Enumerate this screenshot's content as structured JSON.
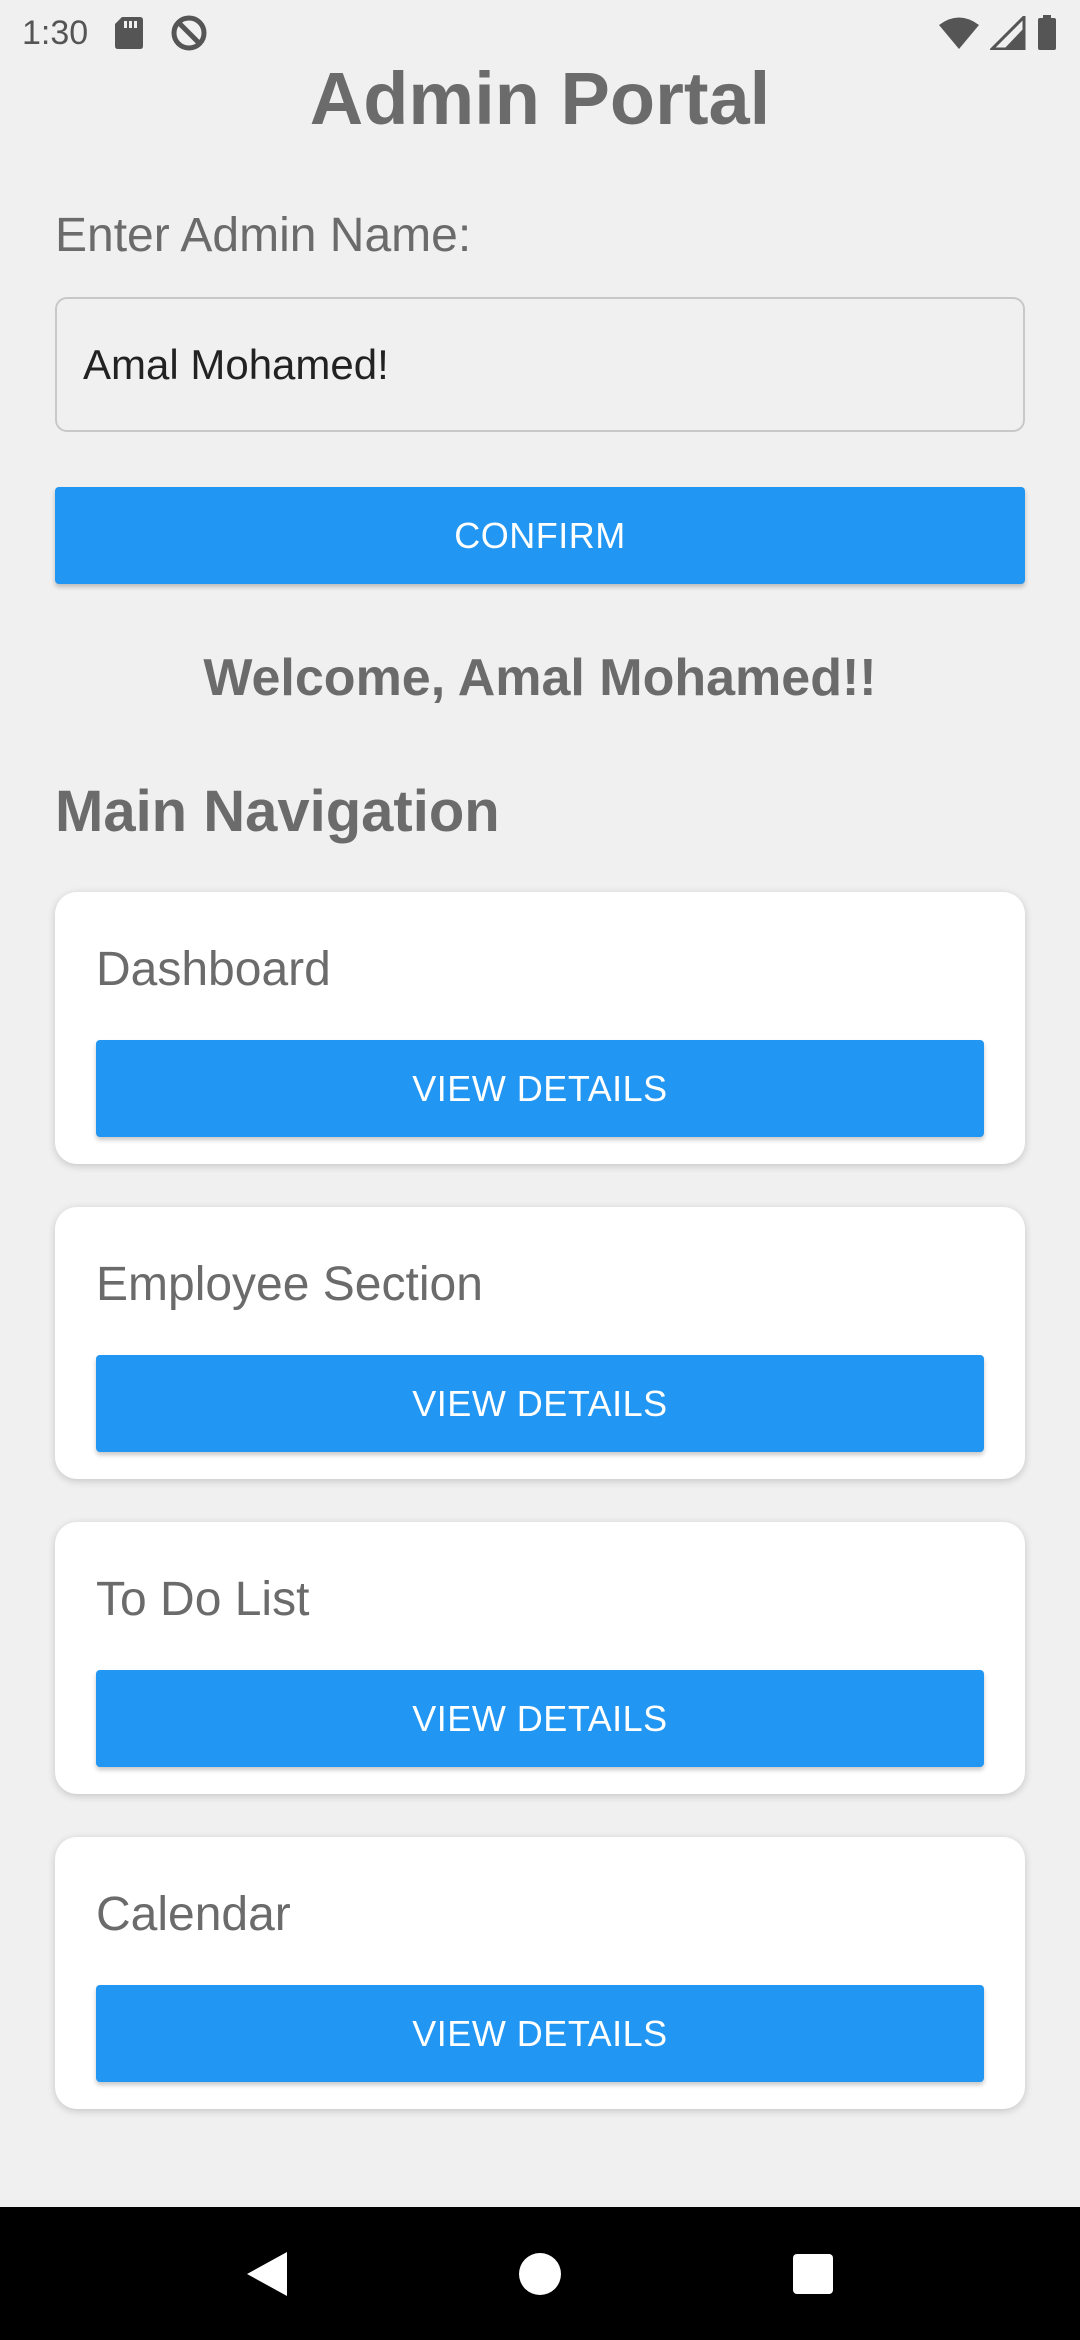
{
  "status_bar": {
    "time": "1:30",
    "icons": [
      "sd-card-icon",
      "data-saver-icon",
      "wifi-icon",
      "signal-icon",
      "battery-icon"
    ]
  },
  "app": {
    "title": "Admin Portal"
  },
  "admin_form": {
    "label": "Enter Admin Name:",
    "name_value": "Amal Mohamed!",
    "confirm_label": "CONFIRM"
  },
  "welcome_text": "Welcome, Amal Mohamed!!",
  "navigation": {
    "heading": "Main Navigation",
    "items": [
      {
        "title": "Dashboard",
        "button": "VIEW DETAILS"
      },
      {
        "title": "Employee Section",
        "button": "VIEW DETAILS"
      },
      {
        "title": "To Do List",
        "button": "VIEW DETAILS"
      },
      {
        "title": "Calendar",
        "button": "VIEW DETAILS"
      }
    ]
  },
  "system_nav": {
    "icons": [
      "back-icon",
      "home-icon",
      "recents-icon"
    ]
  },
  "colors": {
    "accent": "#2196f3",
    "background": "#f0f0f0",
    "text": "#6b6b6b",
    "card": "#ffffff"
  }
}
